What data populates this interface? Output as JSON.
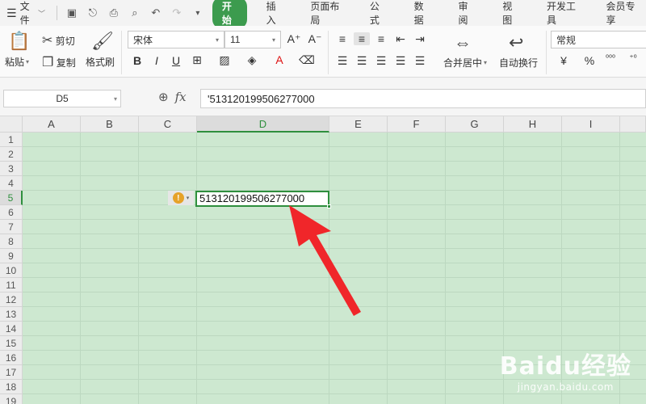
{
  "menubar": {
    "file_label": "文件",
    "tabs": [
      {
        "label": "开始",
        "active": true
      },
      {
        "label": "插入",
        "active": false
      },
      {
        "label": "页面布局",
        "active": false
      },
      {
        "label": "公式",
        "active": false
      },
      {
        "label": "数据",
        "active": false
      },
      {
        "label": "审阅",
        "active": false
      },
      {
        "label": "视图",
        "active": false
      },
      {
        "label": "开发工具",
        "active": false
      },
      {
        "label": "会员专享",
        "active": false
      }
    ]
  },
  "ribbon": {
    "paste_label": "粘贴",
    "cut_label": "剪切",
    "copy_label": "复制",
    "format_painter_label": "格式刷",
    "font_name": "宋体",
    "font_size": "11",
    "merge_label": "合并居中",
    "wrap_label": "自动换行",
    "number_format": "常规",
    "bold_label": "B",
    "italic_label": "I",
    "underline_label": "U",
    "font_color_label": "A",
    "currency_label": "¥",
    "percent_label": "%"
  },
  "formula_bar": {
    "cell_ref": "D5",
    "fx_label": "fx",
    "formula": "'513120199506277000"
  },
  "sheet": {
    "columns": [
      "A",
      "B",
      "C",
      "D",
      "E",
      "F",
      "G",
      "H",
      "I"
    ],
    "rows": [
      "1",
      "2",
      "3",
      "4",
      "5",
      "6",
      "7",
      "8",
      "9",
      "10",
      "11",
      "12",
      "13",
      "14",
      "15",
      "16",
      "17",
      "18",
      "19"
    ],
    "selected_column": "D",
    "selected_row": "5",
    "active_cell_value": "513120199506277000",
    "error_flag": "!"
  },
  "watermark": {
    "main": "Baidu经验",
    "sub": "jingyan.baidu.com"
  },
  "colors": {
    "accent": "#3c9b4e",
    "grid_bg": "#cde8d0",
    "arrow": "#f0262a"
  }
}
